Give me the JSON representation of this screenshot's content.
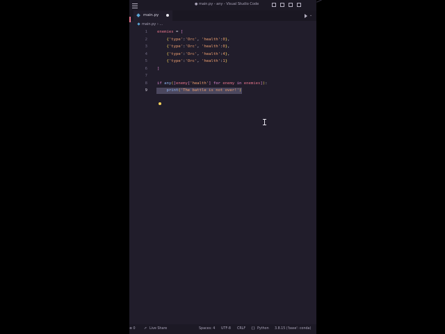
{
  "window": {
    "title": "● main.py - any - Visual Studio Code"
  },
  "icons": {
    "menu": "hamburger-menu-icon",
    "run": "play-icon",
    "bulb": "lightbulb-icon",
    "python_file": "python-file-icon",
    "live_share": "live-share-icon",
    "error": "error-icon"
  },
  "tabs": [
    {
      "label": "main.py",
      "modified": true
    }
  ],
  "breadcrumb": {
    "file": "main.py",
    "rest": "›  ..."
  },
  "editor": {
    "lines": [
      {
        "num": "1",
        "text": "enemies = ["
      },
      {
        "num": "2",
        "text": "    {'type':'Orc', 'health':0},"
      },
      {
        "num": "3",
        "text": "    {'type':'Orc', 'health':0},"
      },
      {
        "num": "4",
        "text": "    {'type':'Orc', 'health':4},"
      },
      {
        "num": "5",
        "text": "    {'type':'Orc', 'health':1}"
      },
      {
        "num": "6",
        "text": "]"
      },
      {
        "num": "7",
        "text": ""
      },
      {
        "num": "8",
        "text": "if any([enemy['health'] for enemy in enemies]):"
      },
      {
        "num": "9",
        "text": "    print('The battle is not over!')"
      }
    ]
  },
  "statusbar": {
    "problems": "⊗ 0",
    "live_share": "Live Share",
    "spaces": "Spaces: 4",
    "encoding": "UTF-8",
    "eol": "CRLF",
    "language": "Python",
    "interpreter": "3.8.15 ('base': conda)"
  },
  "colors": {
    "background": "#211d2b",
    "keyword": "#e28ad4",
    "variable": "#e5738a",
    "string": "#f0a070",
    "function": "#8fb4f0"
  }
}
